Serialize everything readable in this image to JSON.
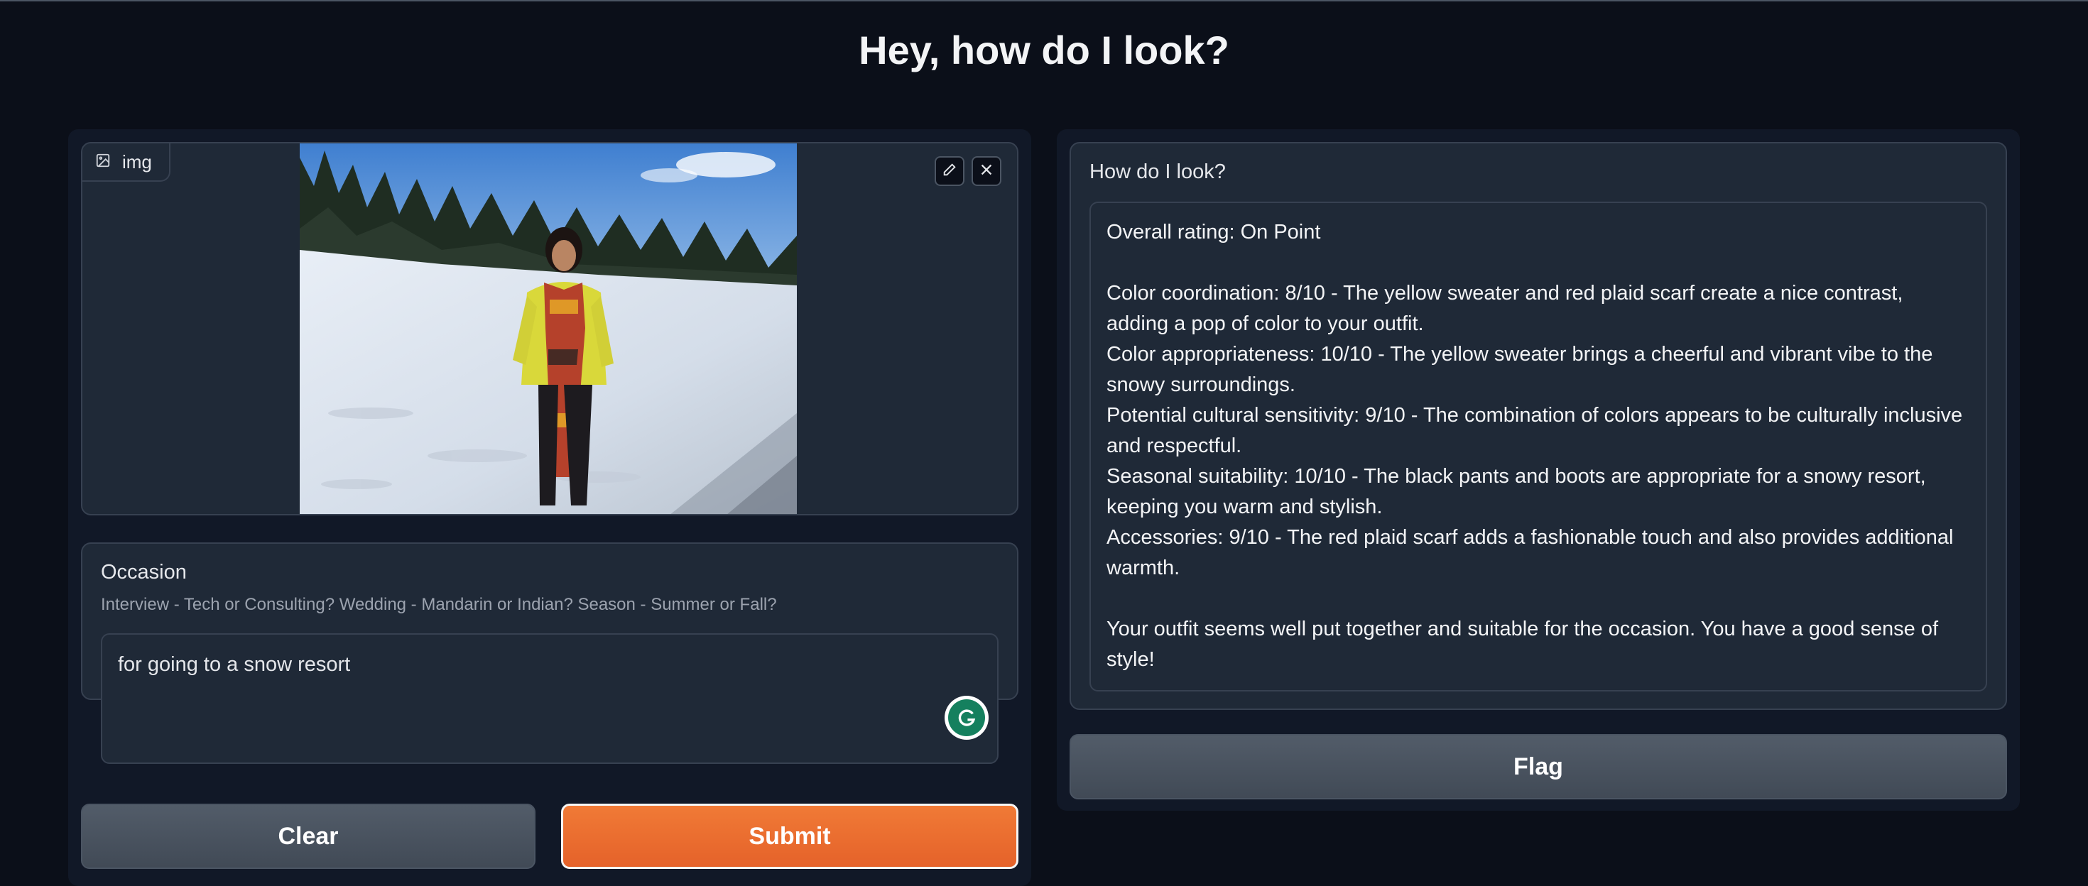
{
  "page": {
    "title": "Hey, how do I look?"
  },
  "input": {
    "image": {
      "label": "img",
      "edit_icon": "pencil-icon",
      "close_icon": "close-icon"
    },
    "occasion": {
      "label": "Occasion",
      "info": "Interview - Tech or Consulting? Wedding - Mandarin or Indian? Season - Summer or Fall?",
      "value": "for going to a snow resort"
    },
    "clear_label": "Clear",
    "submit_label": "Submit"
  },
  "output": {
    "label": "How do I look?",
    "lines": [
      "Overall rating: On Point",
      "",
      "Color coordination: 8/10 - The yellow sweater and red plaid scarf create a nice contrast, adding a pop of color to your outfit.",
      "Color appropriateness: 10/10 - The yellow sweater brings a cheerful and vibrant vibe to the snowy surroundings.",
      "Potential cultural sensitivity: 9/10 - The combination of colors appears to be culturally inclusive and respectful.",
      "Seasonal suitability: 10/10 - The black pants and boots are appropriate for a snowy resort, keeping you warm and stylish.",
      "Accessories: 9/10 - The red plaid scarf adds a fashionable touch and also provides additional warmth.",
      "",
      "Your outfit seems well put together and suitable for the occasion. You have a good sense of style!"
    ],
    "flag_label": "Flag"
  },
  "colors": {
    "background": "#0b0f19",
    "panel": "#1f2937",
    "submit": "#e96b2e",
    "button": "#4b5563"
  }
}
